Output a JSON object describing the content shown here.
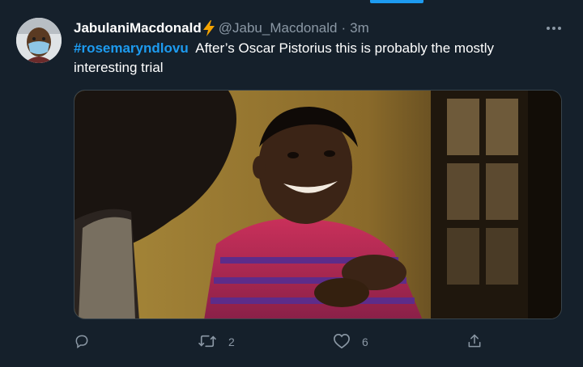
{
  "tweet": {
    "display_name": "JabulaniMacdonald",
    "handle": "@Jabu_Macdonald",
    "separator": "·",
    "time": "3m",
    "hashtag": "#rosemaryndlovu",
    "body": "After’s Oscar Pistorius this is probably the mostly interesting trial",
    "media_icon": "photo",
    "verified_badge_icon": "lightning-bolt-icon"
  },
  "actions": {
    "reply_count": "",
    "retweet_count": "2",
    "like_count": "6",
    "share_count": ""
  },
  "colors": {
    "background": "#15202b",
    "accent": "#1d9bf0",
    "muted": "#8b98a5",
    "bolt": "#f4a300"
  }
}
